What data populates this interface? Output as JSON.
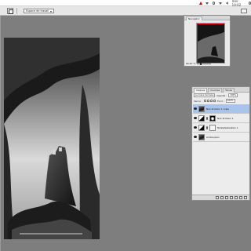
{
  "menubar": {
    "clock": "mer. 10:02",
    "status_icons": [
      "adobe-icon",
      "scripts-icon",
      "sync-icon",
      "wifi-icon",
      "volume-icon",
      "search-icon"
    ]
  },
  "options": {
    "workspace_label": "Espace de travail"
  },
  "navigator": {
    "tab_label": "Navigator",
    "zoom": "66,67 %"
  },
  "layers": {
    "tabs": [
      "Calques",
      "Couches",
      "Tracés"
    ],
    "blend_mode": "Lumière tamisée",
    "opacity_label": "Opacité :",
    "opacity": "100%",
    "lock_label": "Verrou :",
    "fill_label": "Fond :",
    "fill": "100%",
    "items": [
      {
        "name": "Noir et blanc 1 copie",
        "selected": true
      },
      {
        "name": "Noir et blanc 1",
        "selected": false
      },
      {
        "name": "Teinte/Saturation 1",
        "selected": false
      },
      {
        "name": "Arrière-plan",
        "selected": false
      }
    ]
  },
  "colors": {
    "workspace": "#7e7e7e",
    "selection": "#a9c4ea",
    "navigator_box": "#e0001a"
  }
}
